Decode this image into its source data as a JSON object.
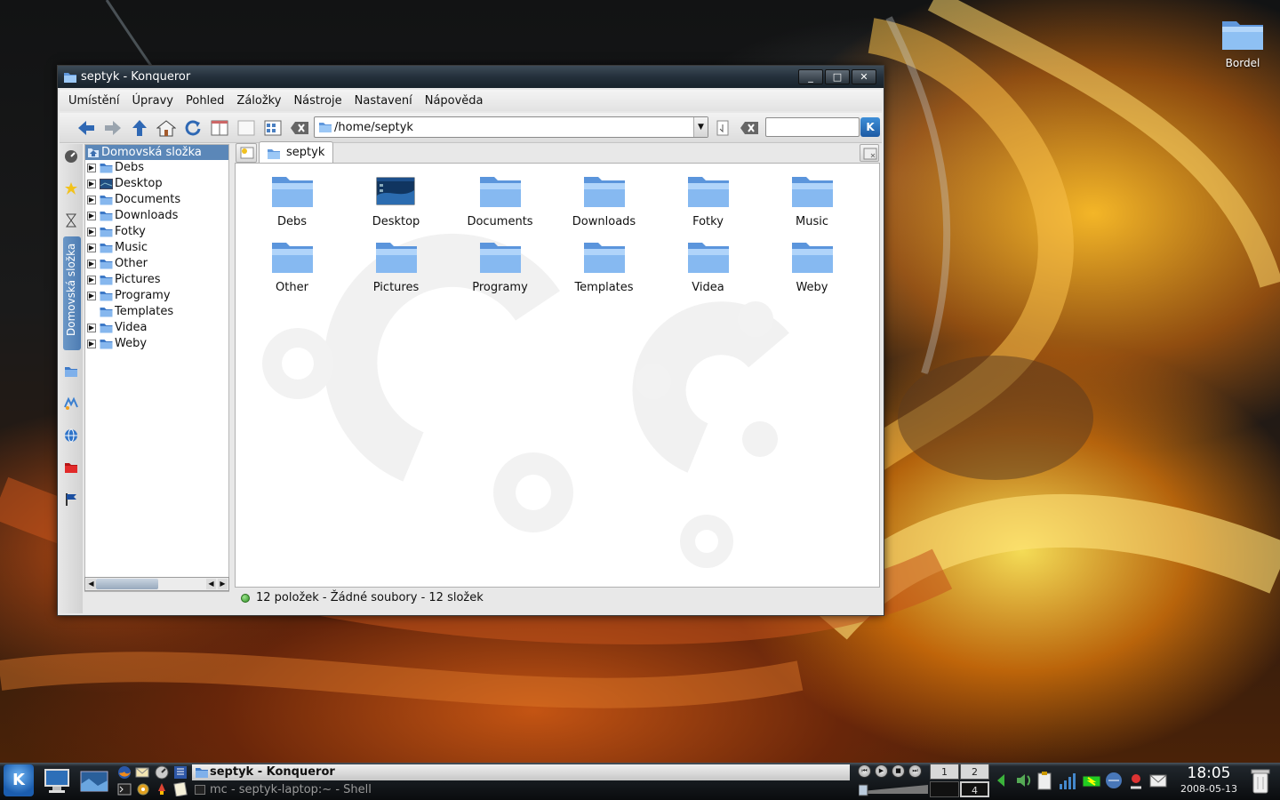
{
  "desktop": {
    "icons": [
      {
        "label": "Bordel"
      }
    ]
  },
  "window": {
    "title": "septyk - Konqueror",
    "buttons": {
      "minimize": "_",
      "maximize": "□",
      "close": "✕"
    },
    "menu": [
      "Umístění",
      "Úpravy",
      "Pohled",
      "Záložky",
      "Nástroje",
      "Nastavení",
      "Nápověda"
    ],
    "toolbar": {
      "location": "/home/septyk",
      "search_placeholder": ""
    },
    "sidebar": {
      "tab_label": "Domovská složka",
      "root": "Domovská složka",
      "items": [
        {
          "label": "Debs",
          "expandable": true
        },
        {
          "label": "Desktop",
          "expandable": true
        },
        {
          "label": "Documents",
          "expandable": true
        },
        {
          "label": "Downloads",
          "expandable": true
        },
        {
          "label": "Fotky",
          "expandable": true
        },
        {
          "label": "Music",
          "expandable": true
        },
        {
          "label": "Other",
          "expandable": true
        },
        {
          "label": "Pictures",
          "expandable": true
        },
        {
          "label": "Programy",
          "expandable": true
        },
        {
          "label": "Templates",
          "expandable": false
        },
        {
          "label": "Videa",
          "expandable": true
        },
        {
          "label": "Weby",
          "expandable": true
        }
      ]
    },
    "tab": {
      "label": "septyk"
    },
    "files": [
      {
        "label": "Debs",
        "icon": "folder-icon"
      },
      {
        "label": "Desktop",
        "icon": "desktop-folder-icon"
      },
      {
        "label": "Documents",
        "icon": "folder-icon"
      },
      {
        "label": "Downloads",
        "icon": "folder-icon"
      },
      {
        "label": "Fotky",
        "icon": "folder-icon"
      },
      {
        "label": "Music",
        "icon": "folder-icon"
      },
      {
        "label": "Other",
        "icon": "folder-icon"
      },
      {
        "label": "Pictures",
        "icon": "folder-icon"
      },
      {
        "label": "Programy",
        "icon": "folder-icon"
      },
      {
        "label": "Templates",
        "icon": "folder-icon"
      },
      {
        "label": "Videa",
        "icon": "folder-icon"
      },
      {
        "label": "Weby",
        "icon": "folder-icon"
      }
    ],
    "status": "12 položek - Žádné soubory - 12 složek"
  },
  "taskbar": {
    "tasks": [
      {
        "label": "septyk - Konqueror",
        "active": true
      },
      {
        "label": "mc - septyk-laptop:~ - Shell",
        "active": false
      }
    ],
    "pager": [
      "1",
      "2",
      "3",
      "4"
    ],
    "clock": {
      "time": "18:05",
      "date": "2008-05-13"
    }
  },
  "colors": {
    "selection": "#5b87b8",
    "titlebar": "#24303b",
    "folder": "#7fb0ea"
  }
}
